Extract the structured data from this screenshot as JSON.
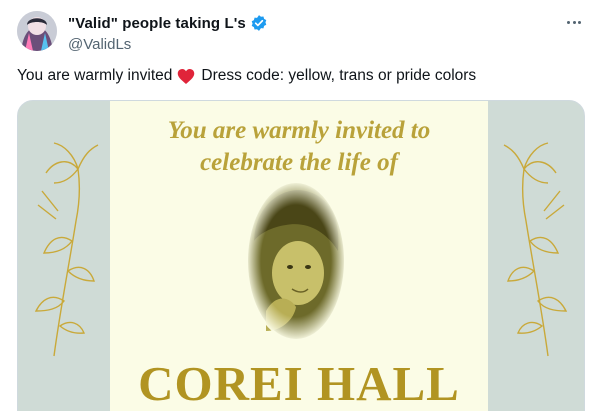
{
  "author": {
    "display_name": "\"Valid\" people taking L's",
    "handle": "@ValidLs",
    "verified_icon": "verified-badge-icon"
  },
  "more_icon": "more-options-icon",
  "tweet": {
    "text_before": "You are warmly invited",
    "emoji": "red-heart-emoji",
    "text_after": "Dress code: yellow, trans or pride colors"
  },
  "media": {
    "invite_line_1": "You are warmly invited to",
    "invite_line_2": "celebrate the life of",
    "name": "COREI HALL"
  },
  "colors": {
    "accent_gold": "#b19422",
    "verified_blue": "#1d9bf0",
    "heart_red": "#e0243a",
    "card_background": "#fbfce6",
    "media_background": "#cfdbd6"
  }
}
